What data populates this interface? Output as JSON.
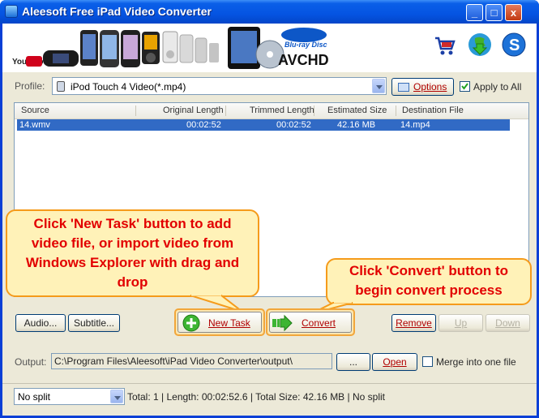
{
  "window": {
    "title": "Aleesoft Free iPad Video Converter",
    "controls": {
      "minimize": "_",
      "maximize": "□",
      "close": "x"
    }
  },
  "banner": {
    "logos": [
      "youtube-logo",
      "devices-strip",
      "ipad",
      "dvd-disc",
      "bluray-avchd-logo"
    ],
    "youtube_text": "You Tube",
    "bluray_text": "Blu-ray Disc",
    "avchd_text": "AVCHD",
    "tools": [
      "cart-icon",
      "update-download-icon",
      "help-s-icon"
    ]
  },
  "profile": {
    "label": "Profile:",
    "value": "iPod Touch 4 Video(*.mp4)",
    "options_label": "Options",
    "apply_all_label": "Apply to All",
    "apply_all_checked": true
  },
  "file_list": {
    "columns": [
      "Source",
      "Original Length",
      "Trimmed Length",
      "Estimated Size",
      "Destination File"
    ],
    "rows": [
      {
        "source": "14.wmv",
        "original_length": "00:02:52",
        "trimmed_length": "00:02:52",
        "estimated_size": "42.16 MB",
        "destination": "14.mp4"
      }
    ]
  },
  "callouts": {
    "new_task": "Click 'New Task' button to add video file, or import video from Windows Explorer with drag and drop",
    "convert": "Click 'Convert' button to begin convert process"
  },
  "buttons": {
    "audio": "Audio...",
    "subtitle": "Subtitle...",
    "new_task": "New Task",
    "convert": "Convert",
    "remove": "Remove",
    "up": "Up",
    "down": "Down",
    "browse": "...",
    "open": "Open"
  },
  "output": {
    "label": "Output:",
    "path": "C:\\Program Files\\Aleesoft\\iPad Video Converter\\output\\",
    "merge_label": "Merge into one file",
    "merge_checked": false
  },
  "status": {
    "split_value": "No split",
    "summary": "Total: 1 | Length: 00:02:52.6 | Total Size: 42.16 MB | No split"
  },
  "colors": {
    "accent": "#0a5fe8",
    "selection": "#316ac5",
    "callout_text": "#e20000",
    "callout_fill": "#fff2b8",
    "callout_border": "#f59b1b"
  }
}
